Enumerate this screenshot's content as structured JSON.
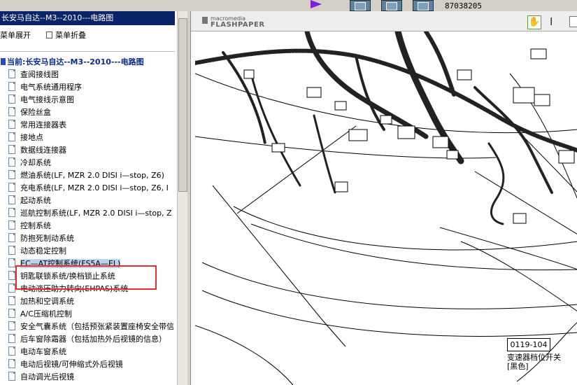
{
  "top": {
    "number": "87038205"
  },
  "sidebar": {
    "title": "长安马自达--M3--2010---电路图",
    "expand_label": "菜单展开",
    "collapse_label": "菜单折叠",
    "root_label": "当前:长安马自达--M3--2010---电路图",
    "items": [
      {
        "label": "查阅接线图"
      },
      {
        "label": "电气系统通用程序"
      },
      {
        "label": "电气接线示意图"
      },
      {
        "label": "保险丝盒"
      },
      {
        "label": "常用连接器表"
      },
      {
        "label": "接地点"
      },
      {
        "label": "数据线连接器"
      },
      {
        "label": "冷却系统"
      },
      {
        "label": "燃油系统(LF, MZR 2.0 DISI i—stop, Z6)"
      },
      {
        "label": "充电系统(LF, MZR 2.0 DISI i—stop, Z6, I"
      },
      {
        "label": "起动系统"
      },
      {
        "label": "巡航控制系统(LF, MZR 2.0 DISI i—stop, Z"
      },
      {
        "label": "控制系统"
      },
      {
        "label": "防抱死制动系统"
      },
      {
        "label": "动态稳定控制"
      },
      {
        "label": "EC—AT控制系统(FS5A—EL)"
      },
      {
        "label": "钥匙联锁系统/换档锁止系统"
      },
      {
        "label": "电动液压助力转向(EHPAS)系统"
      },
      {
        "label": "加热和空调系统"
      },
      {
        "label": "A/C压缩机控制"
      },
      {
        "label": "安全气囊系统（包括预张紧装置座椅安全带信"
      },
      {
        "label": "后车窗除霜器（包括加热外后视镜的信息）"
      },
      {
        "label": "电动车窗系统"
      },
      {
        "label": "电动后视镜/可伸缩式外后视镜"
      },
      {
        "label": "自动调光后视镜"
      }
    ],
    "selected_index": 15
  },
  "viewer": {
    "logo_top": "macromedia",
    "logo_brand": "FLASHPAPER",
    "callout_code": "0119-104",
    "callout_name": "变速器档位开关",
    "callout_color": "[黑色]"
  },
  "colors": {
    "titlebar": "#0a246a",
    "highlight": "#e03030",
    "selection": "#bcd2ee"
  }
}
